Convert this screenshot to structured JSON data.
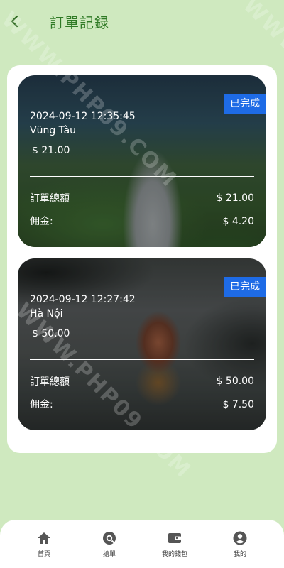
{
  "header": {
    "back_icon": "chevron-left-icon",
    "title": "訂單記録"
  },
  "watermark": "WWW.PHP09.COM",
  "orders": [
    {
      "status": "已完成",
      "datetime": "2024-09-12 12:35:45",
      "location": "Vũng Tàu",
      "price": "$ 21.00",
      "total_label": "訂單總額",
      "total_value": "$ 21.00",
      "commission_label": "佣金:",
      "commission_value": "$ 4.20"
    },
    {
      "status": "已完成",
      "datetime": "2024-09-12 12:27:42",
      "location": "Hà Nội",
      "price": "$ 50.00",
      "total_label": "訂單總額",
      "total_value": "$ 50.00",
      "commission_label": "佣金:",
      "commission_value": "$ 7.50"
    }
  ],
  "tabs": [
    {
      "label": "首頁",
      "icon": "home-icon"
    },
    {
      "label": "搶單",
      "icon": "search-order-icon"
    },
    {
      "label": "我的錢包",
      "icon": "wallet-icon"
    },
    {
      "label": "我的",
      "icon": "user-icon"
    }
  ],
  "colors": {
    "background": "#cfe9bf",
    "title": "#2f7a25",
    "badge": "#1e6be6",
    "tab_icon": "#555555"
  }
}
